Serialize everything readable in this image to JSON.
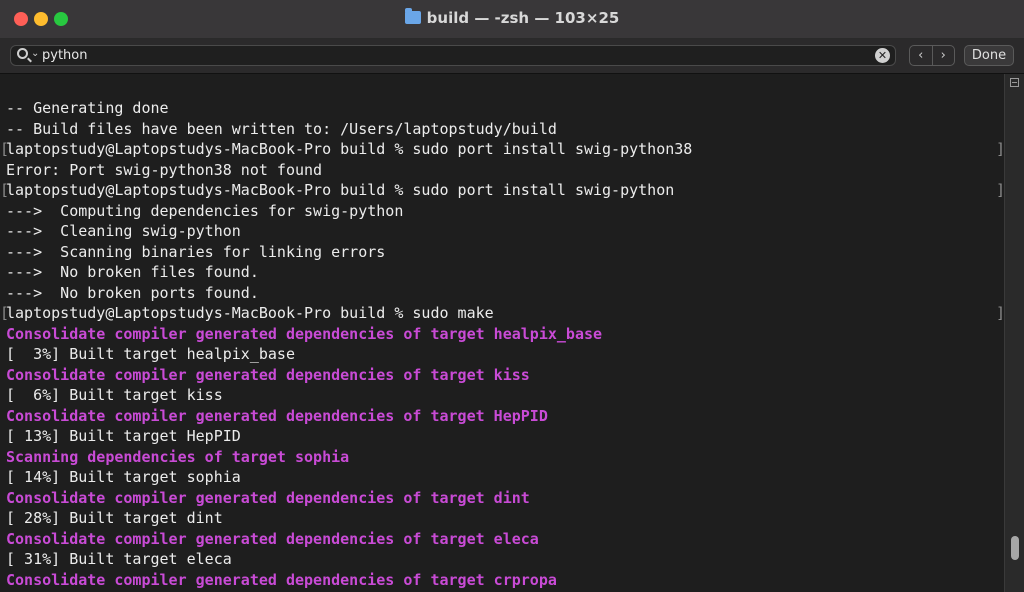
{
  "window": {
    "title": "build — -zsh — 103×25"
  },
  "find": {
    "query": "python",
    "clear": "✕",
    "prev": "‹",
    "next": "›",
    "done": "Done",
    "caret": "⌄"
  },
  "terminal": {
    "lines": [
      {
        "text": "-- Generating done",
        "style": "normal"
      },
      {
        "text": "-- Build files have been written to: /Users/laptopstudy/build",
        "style": "normal"
      },
      {
        "text": "laptopstudy@Laptopstudys-MacBook-Pro build % sudo port install swig-python38",
        "style": "normal",
        "marked": true
      },
      {
        "text": "Error: Port swig-python38 not found",
        "style": "normal"
      },
      {
        "text": "laptopstudy@Laptopstudys-MacBook-Pro build % sudo port install swig-python",
        "style": "normal",
        "marked": true
      },
      {
        "text": "--->  Computing dependencies for swig-python",
        "style": "normal"
      },
      {
        "text": "--->  Cleaning swig-python",
        "style": "normal"
      },
      {
        "text": "--->  Scanning binaries for linking errors",
        "style": "normal"
      },
      {
        "text": "--->  No broken files found.",
        "style": "normal"
      },
      {
        "text": "--->  No broken ports found.",
        "style": "normal"
      },
      {
        "text": "laptopstudy@Laptopstudys-MacBook-Pro build % sudo make",
        "style": "normal",
        "marked": true
      },
      {
        "text": "Consolidate compiler generated dependencies of target healpix_base",
        "style": "magenta"
      },
      {
        "text": "[  3%] Built target healpix_base",
        "style": "normal"
      },
      {
        "text": "Consolidate compiler generated dependencies of target kiss",
        "style": "magenta"
      },
      {
        "text": "[  6%] Built target kiss",
        "style": "normal"
      },
      {
        "text": "Consolidate compiler generated dependencies of target HepPID",
        "style": "magenta"
      },
      {
        "text": "[ 13%] Built target HepPID",
        "style": "normal"
      },
      {
        "text": "Scanning dependencies of target sophia",
        "style": "magenta"
      },
      {
        "text": "[ 14%] Built target sophia",
        "style": "normal"
      },
      {
        "text": "Consolidate compiler generated dependencies of target dint",
        "style": "magenta"
      },
      {
        "text": "[ 28%] Built target dint",
        "style": "normal"
      },
      {
        "text": "Consolidate compiler generated dependencies of target eleca",
        "style": "magenta"
      },
      {
        "text": "[ 31%] Built target eleca",
        "style": "normal"
      },
      {
        "text": "Consolidate compiler generated dependencies of target crpropa",
        "style": "magenta"
      }
    ],
    "mark_left": "[",
    "mark_right": "]"
  },
  "colors": {
    "background": "#1e1e1e",
    "text": "#ececec",
    "magenta": "#c94bd6",
    "close": "#fe5f57",
    "minimize": "#febc2e",
    "maximize": "#28c840"
  },
  "icons": [
    "folder-icon",
    "search-icon",
    "clear-search-icon",
    "chevron-left-icon",
    "chevron-right-icon"
  ]
}
